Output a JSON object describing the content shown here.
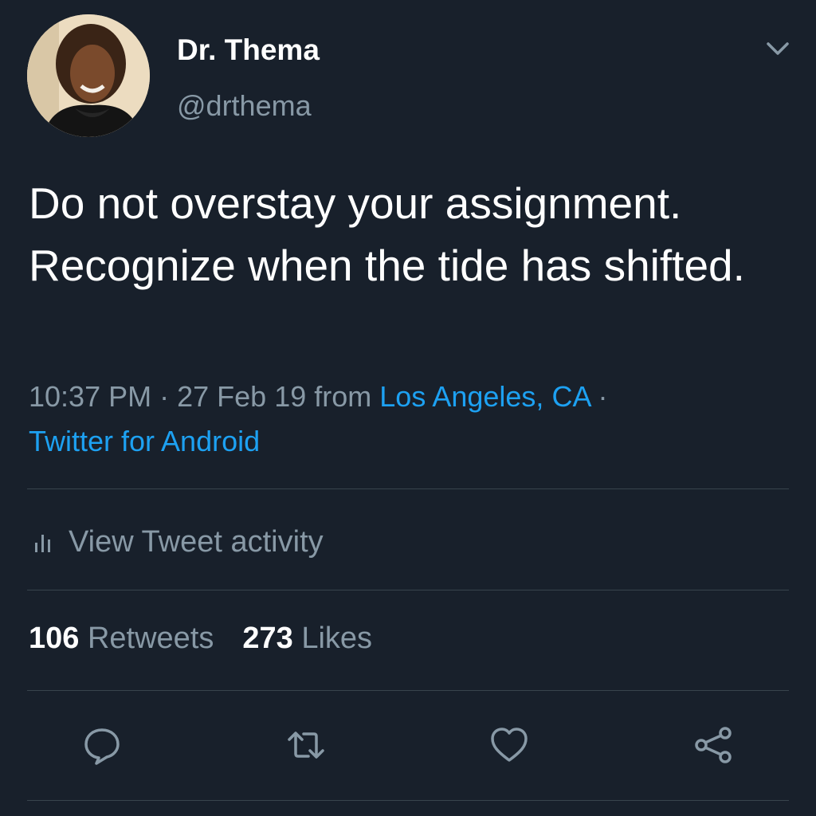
{
  "user": {
    "name": "Dr. Thema",
    "handle": "@drthema"
  },
  "tweet": {
    "text": "Do not overstay your assignment. Recognize when the tide has shifted.",
    "time": "10:37 PM",
    "date": "27 Feb 19",
    "from_label": "from",
    "location": "Los Angeles, CA",
    "separator": "·",
    "source": "Twitter for Android"
  },
  "activity": {
    "label": "View Tweet activity",
    "icon": "bar-chart-icon"
  },
  "stats": {
    "retweets_count": "106",
    "retweets_label": "Retweets",
    "likes_count": "273",
    "likes_label": "Likes"
  },
  "actions": {
    "reply_icon": "reply-icon",
    "retweet_icon": "retweet-icon",
    "like_icon": "heart-icon",
    "share_icon": "share-icon"
  },
  "colors": {
    "background": "#18202b",
    "primary_text": "#ffffff",
    "secondary_text": "#8899a6",
    "link": "#1da1f2",
    "divider": "#38444d"
  }
}
